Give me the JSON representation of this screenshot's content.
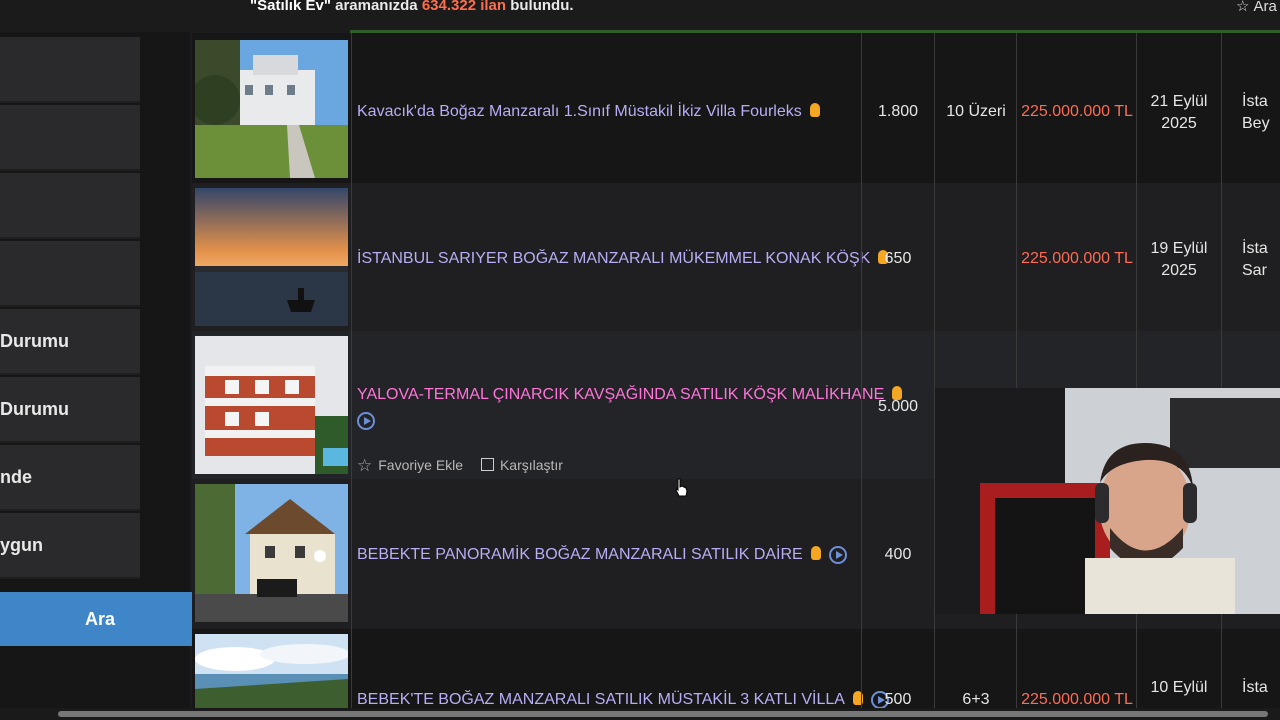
{
  "search_summary": {
    "query": "\"Satılık Ev\"",
    "middle": " aramanızda ",
    "count": "634.322 ilan",
    "suffix": " bulundu."
  },
  "save_search": {
    "label": "Ara"
  },
  "sidebar": {
    "items": [
      {
        "label": ""
      },
      {
        "label": ""
      },
      {
        "label": ""
      },
      {
        "label": ""
      },
      {
        "label": "Durumu"
      },
      {
        "label": "nde"
      },
      {
        "label": "ygun"
      }
    ],
    "search_button": "Ara"
  },
  "listings": [
    {
      "title": "Kavacık'da Boğaz Manzaralı 1.Sınıf Müstakil İkiz Villa Fourleks",
      "m2": "1.800",
      "rooms": "10 Üzeri",
      "price": "225.000.000 TL",
      "date_day": "21 Eylül",
      "date_year": "2025",
      "loc_city": "İsta",
      "loc_district": "Bey"
    },
    {
      "title": "İSTANBUL SARIYER BOĞAZ MANZARALI MÜKEMMEL KONAK KÖŞK",
      "m2": "650",
      "rooms": "",
      "price": "225.000.000 TL",
      "date_day": "19 Eylül",
      "date_year": "2025",
      "loc_city": "İsta",
      "loc_district": "Sar"
    },
    {
      "title": "YALOVA-TERMAL ÇINARCIK KAVŞAĞINDA SATILIK KÖŞK MALİKHANE",
      "m2": "5.000",
      "favorite_label": "Favoriye Ekle",
      "compare_label": "Karşılaştır"
    },
    {
      "title": "BEBEKTE PANORAMİK BOĞAZ MANZARALI SATILIK DAİRE",
      "m2": "400"
    },
    {
      "title": "BEBEK'TE BOĞAZ MANZARALI SATILIK MÜSTAKİL 3 KATLI VİLLA",
      "m2": "500",
      "rooms": "6+3",
      "price": "225.000.000 TL",
      "date_day": "10 Eylül",
      "loc_city": "İsta"
    }
  ],
  "colors": {
    "price": "#ff6b55",
    "title": "#b7aef5",
    "title_highlight": "#ff74d8",
    "search_button": "#3f86c9"
  }
}
